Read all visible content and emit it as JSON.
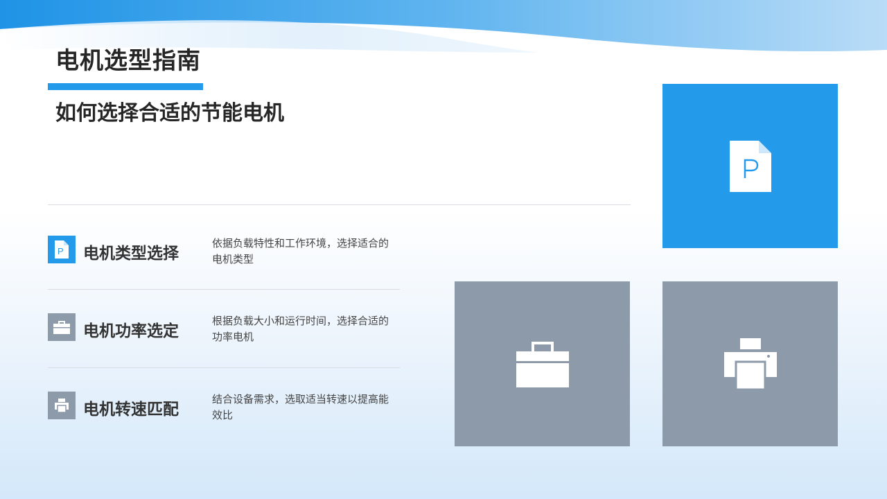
{
  "title": "电机选型指南",
  "subtitle": "如何选择合适的节能电机",
  "rows": [
    {
      "title": "电机类型选择",
      "description": "依据负载特性和工作环境，选择适合的电机类型",
      "icon": "document-p-icon"
    },
    {
      "title": "电机功率选定",
      "description": "根据负载大小和运行时间，选择合适的功率电机",
      "icon": "toolbox-icon"
    },
    {
      "title": "电机转速匹配",
      "description": "结合设备需求，选取适当转速以提高能效比",
      "icon": "printer-icon"
    }
  ],
  "tiles": [
    {
      "icon": "document-p-icon",
      "color": "#239bea"
    },
    {
      "icon": "toolbox-icon",
      "color": "#8c9aaa"
    },
    {
      "icon": "printer-icon",
      "color": "#8c9aaa"
    }
  ],
  "colors": {
    "accent": "#239bea",
    "muted": "#8c9aaa",
    "text": "#262626"
  },
  "icon_letter": "P"
}
